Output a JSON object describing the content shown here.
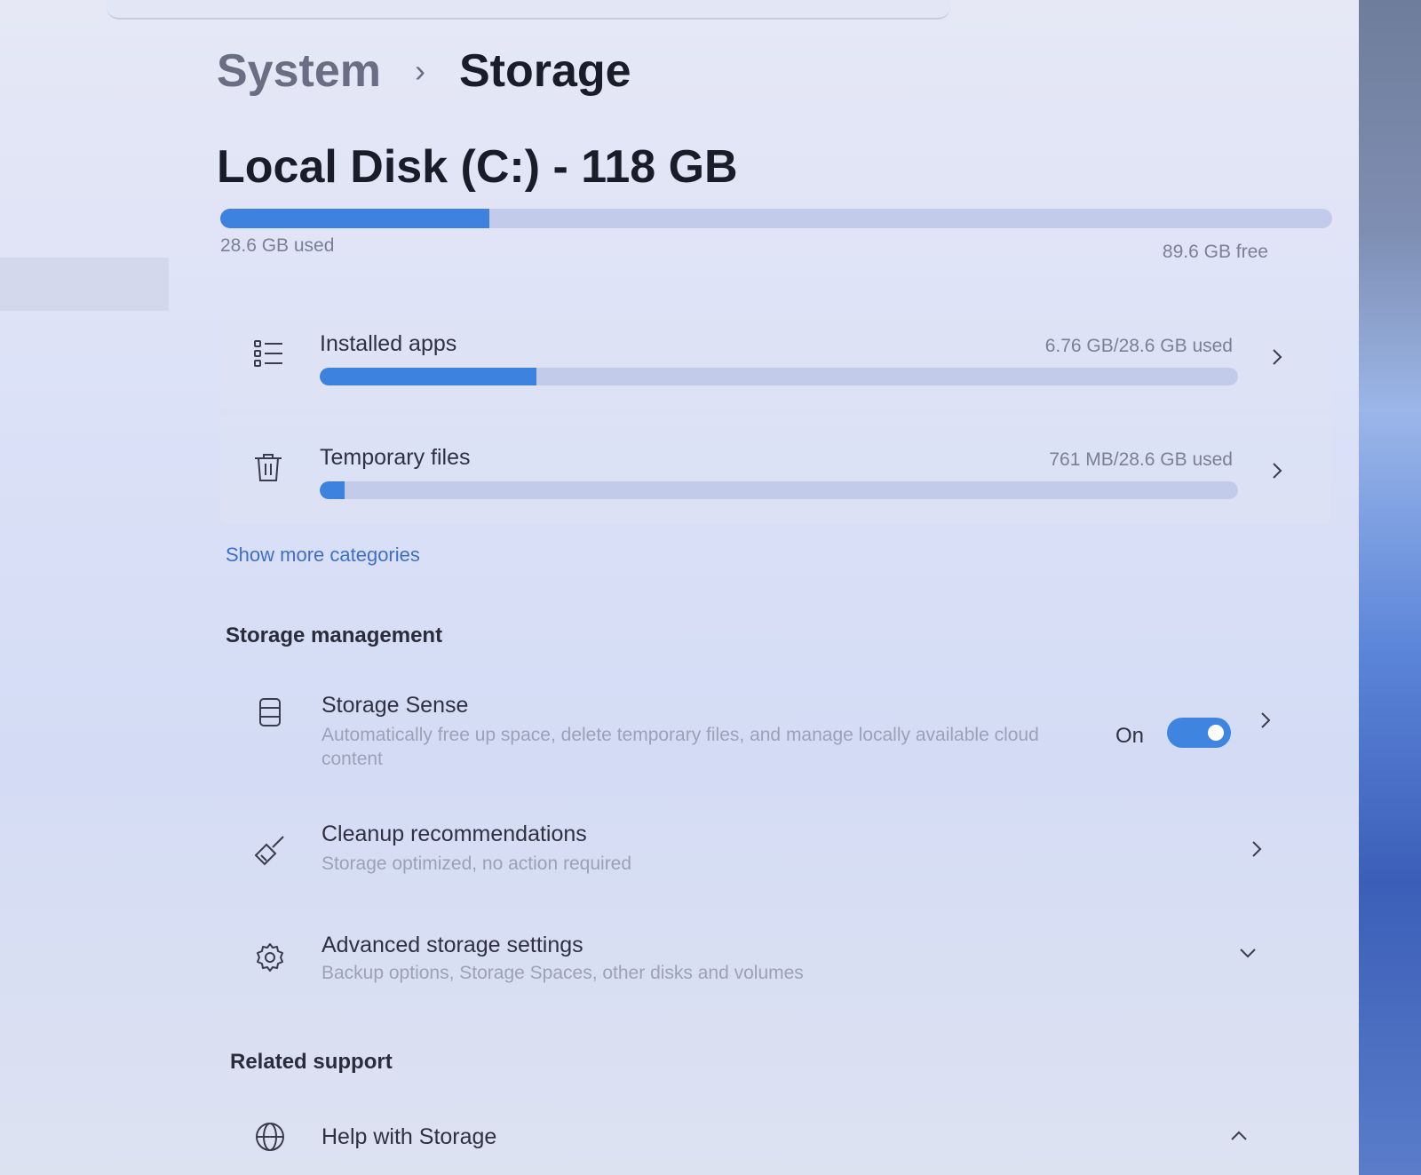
{
  "breadcrumb": {
    "parent": "System",
    "separator": "›",
    "current": "Storage"
  },
  "disk": {
    "title": "Local Disk (C:) - 118 GB",
    "used_label": "28.6 GB used",
    "free_label": "89.6 GB free",
    "used_fraction": 0.242
  },
  "categories": [
    {
      "title": "Installed apps",
      "usage": "6.76 GB/28.6 GB used",
      "fraction": 0.236,
      "icon": "list-icon"
    },
    {
      "title": "Temporary files",
      "usage": "761 MB/28.6 GB used",
      "fraction": 0.027,
      "icon": "trash-icon"
    }
  ],
  "show_more": "Show more categories",
  "storage_management": {
    "heading": "Storage management",
    "storage_sense": {
      "title": "Storage Sense",
      "desc": "Automatically free up space, delete temporary files, and manage locally available cloud content",
      "toggle_label": "On",
      "toggle_on": true,
      "icon": "drive-icon"
    },
    "cleanup": {
      "title": "Cleanup recommendations",
      "desc": "Storage optimized, no action required",
      "icon": "broom-icon"
    },
    "advanced": {
      "title": "Advanced storage settings",
      "desc": "Backup options, Storage Spaces, other disks and volumes",
      "icon": "gear-icon"
    }
  },
  "related_support": {
    "heading": "Related support",
    "help": {
      "title": "Help with Storage",
      "icon": "globe-icon"
    }
  },
  "colors": {
    "accent": "#3d82de",
    "track": "#c3cbea",
    "link": "#3f6fc8"
  }
}
